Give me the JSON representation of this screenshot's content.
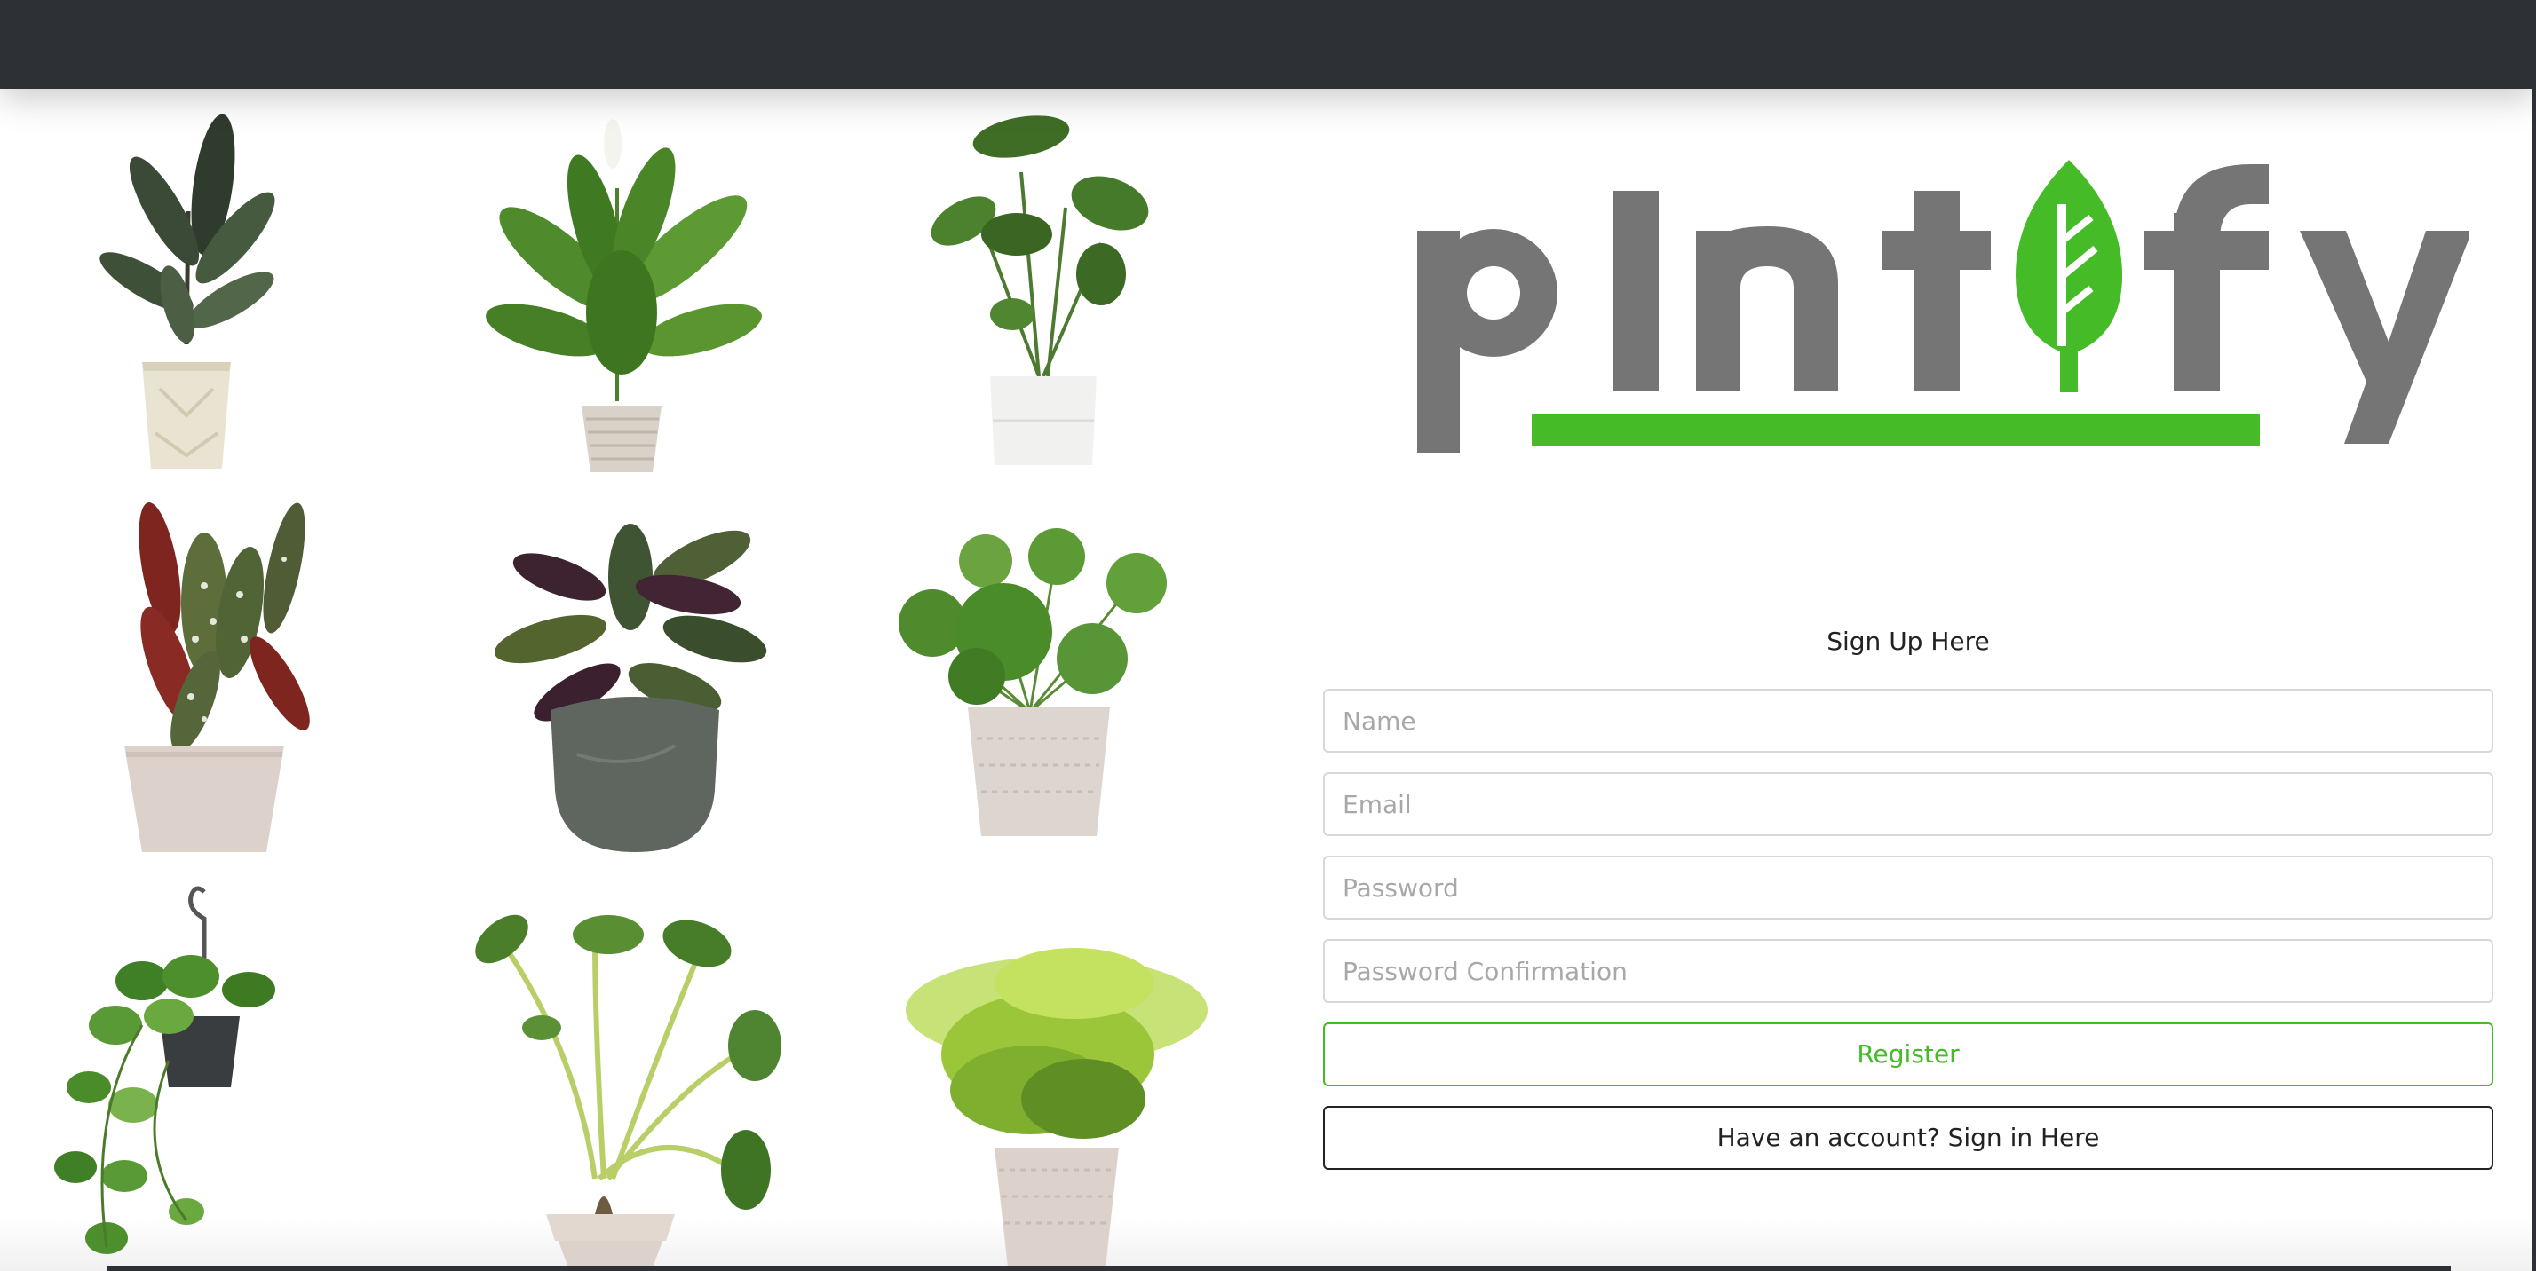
{
  "brand": {
    "logo_text": "plntify",
    "logo_colors": {
      "letters": "#757575",
      "leaf": "#44bb27",
      "underline": "#44bb27"
    }
  },
  "plants": [
    {
      "name": "rubber-plant"
    },
    {
      "name": "peace-lily"
    },
    {
      "name": "monstera-small"
    },
    {
      "name": "begonia-maculata"
    },
    {
      "name": "calathea"
    },
    {
      "name": "pilea"
    },
    {
      "name": "hanging-pothos"
    },
    {
      "name": "alocasia"
    },
    {
      "name": "asparagus-fern"
    }
  ],
  "signup_form": {
    "title": "Sign Up Here",
    "name_placeholder": "Name",
    "email_placeholder": "Email",
    "password_placeholder": "Password",
    "password_confirmation_placeholder": "Password Confirmation",
    "register_label": "Register",
    "signin_label": "Have an account? Sign in Here"
  },
  "colors": {
    "topbar": "#2d3034",
    "accent_green": "#44bb27",
    "input_border": "#d8d8d8"
  }
}
